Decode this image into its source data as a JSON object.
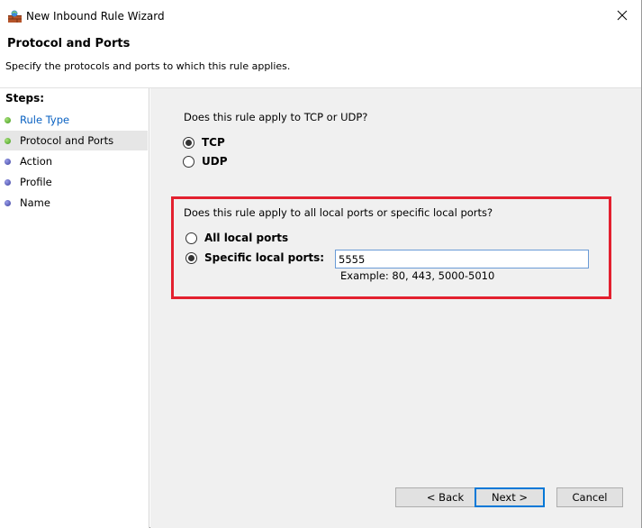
{
  "window": {
    "title": "New Inbound Rule Wizard",
    "icon": "firewall-icon",
    "close_icon": "close-icon"
  },
  "header": {
    "title": "Protocol and Ports",
    "subtitle": "Specify the protocols and ports to which this rule applies."
  },
  "steps": {
    "heading": "Steps:",
    "items": [
      {
        "label": "Rule Type",
        "status": "completed",
        "color": "#3f9a1a"
      },
      {
        "label": "Protocol and Ports",
        "status": "current",
        "color": "#3f9a1a"
      },
      {
        "label": "Action",
        "status": "pending",
        "color": "#3b3f9e"
      },
      {
        "label": "Profile",
        "status": "pending",
        "color": "#3b3f9e"
      },
      {
        "label": "Name",
        "status": "pending",
        "color": "#3b3f9e"
      }
    ]
  },
  "protocol": {
    "question": "Does this rule apply to TCP or UDP?",
    "options": [
      {
        "label": "TCP",
        "checked": true
      },
      {
        "label": "UDP",
        "checked": false
      }
    ]
  },
  "ports": {
    "question": "Does this rule apply to all local ports or specific local ports?",
    "options": [
      {
        "label": "All local ports",
        "checked": false
      },
      {
        "label": "Specific local ports:",
        "checked": true
      }
    ],
    "value": "5555",
    "example": "Example: 80, 443, 5000-5010"
  },
  "buttons": {
    "back": "< Back",
    "next": "Next >",
    "cancel": "Cancel"
  },
  "colors": {
    "highlight": "#e3202f",
    "link": "#0a62c2",
    "panel_bg": "#f0f0f0"
  }
}
